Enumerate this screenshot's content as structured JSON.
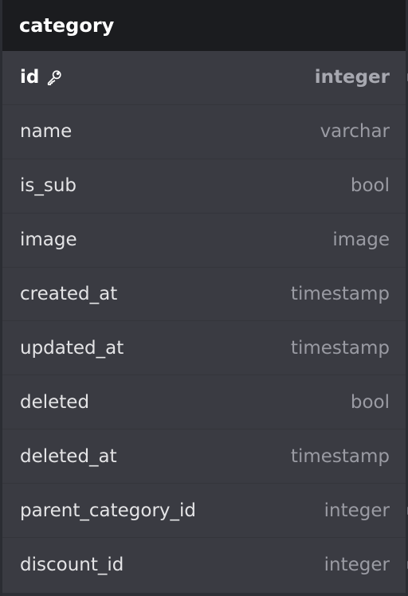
{
  "table": {
    "title": "category",
    "fields": [
      {
        "name": "id",
        "type": "integer",
        "primary": true
      },
      {
        "name": "name",
        "type": "varchar"
      },
      {
        "name": "is_sub",
        "type": "bool"
      },
      {
        "name": "image",
        "type": "image"
      },
      {
        "name": "created_at",
        "type": "timestamp"
      },
      {
        "name": "updated_at",
        "type": "timestamp"
      },
      {
        "name": "deleted",
        "type": "bool"
      },
      {
        "name": "deleted_at",
        "type": "timestamp"
      },
      {
        "name": "parent_category_id",
        "type": "integer",
        "connector": true
      },
      {
        "name": "discount_id",
        "type": "integer",
        "connector": true
      }
    ],
    "primary_key_icon": "key-icon",
    "colors": {
      "header_bg": "#1b1c1f",
      "body_bg": "#3a3b42",
      "text": "#e4e4e6",
      "type_text": "#9a9ba3"
    }
  }
}
